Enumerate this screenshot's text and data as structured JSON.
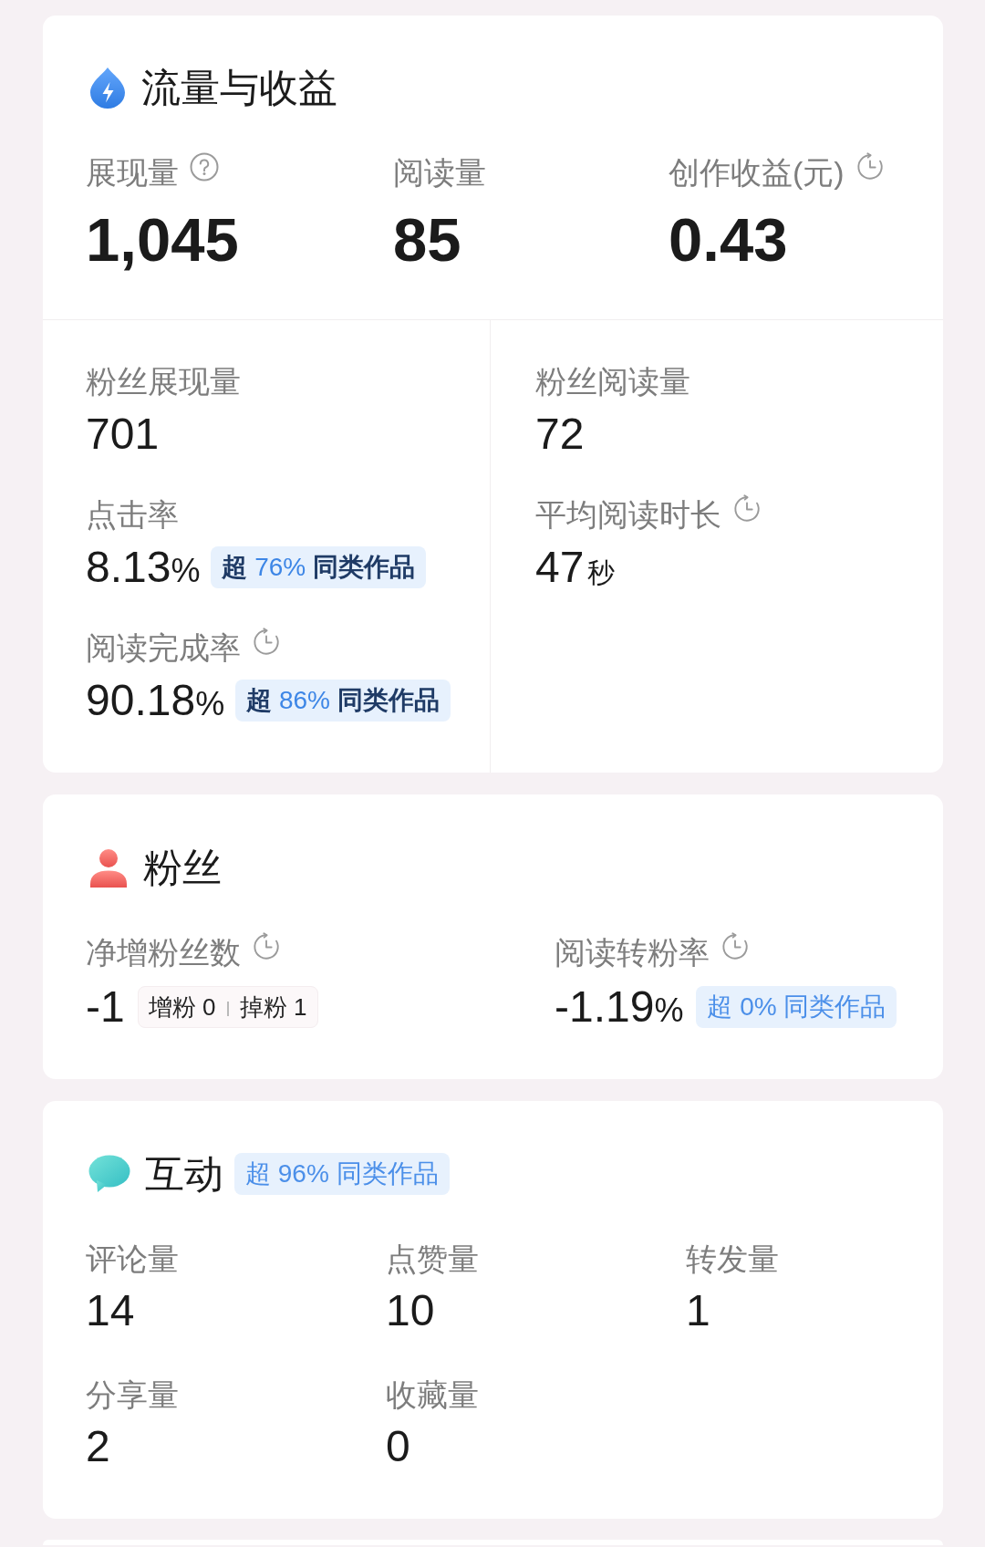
{
  "traffic_revenue": {
    "title": "流量与收益",
    "headline": [
      {
        "label": "展现量",
        "kind": "help",
        "value": "1,045"
      },
      {
        "label": "阅读量",
        "kind": "plain",
        "value": "85"
      },
      {
        "label": "创作收益(元)",
        "kind": "delayed",
        "value": "0.43"
      }
    ],
    "columns": [
      [
        {
          "label": "粉丝展现量",
          "kind": "plain",
          "value": "701"
        },
        {
          "label": "点击率",
          "kind": "plain",
          "value": "8.13",
          "unit": "%",
          "badge": {
            "prefix": "超",
            "percent": "76%",
            "suffix": "同类作品",
            "emphasis": true
          }
        },
        {
          "label": "阅读完成率",
          "kind": "delayed",
          "value": "90.18",
          "unit": "%",
          "badge": {
            "prefix": "超",
            "percent": "86%",
            "suffix": "同类作品",
            "emphasis": true
          }
        }
      ],
      [
        {
          "label": "粉丝阅读量",
          "kind": "plain",
          "value": "72"
        },
        {
          "label": "平均阅读时长",
          "kind": "delayed",
          "value": "47",
          "unit": "秒"
        }
      ]
    ]
  },
  "fans": {
    "title": "粉丝",
    "stats": [
      {
        "label": "净增粉丝数",
        "kind": "delayed",
        "value": "-1",
        "breakdown": [
          {
            "label": "增粉",
            "value": "0"
          },
          {
            "label": "掉粉",
            "value": "1"
          }
        ]
      },
      {
        "label": "阅读转粉率",
        "kind": "delayed",
        "value": "-1.19",
        "unit": "%",
        "badge": {
          "prefix": "超",
          "percent": "0%",
          "suffix": "同类作品",
          "emphasis": false
        }
      }
    ]
  },
  "interaction": {
    "title": "互动",
    "badge": {
      "prefix": "超",
      "percent": "96%",
      "suffix": "同类作品",
      "emphasis": false
    },
    "stats": [
      {
        "label": "评论量",
        "value": "14"
      },
      {
        "label": "点赞量",
        "value": "10"
      },
      {
        "label": "转发量",
        "value": "1"
      },
      {
        "label": "分享量",
        "value": "2"
      },
      {
        "label": "收藏量",
        "value": "0"
      }
    ]
  }
}
